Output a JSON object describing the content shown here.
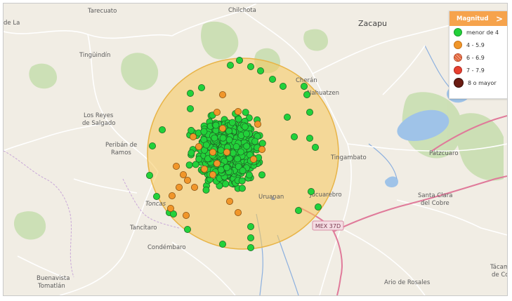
{
  "colors": {
    "circle_fill": "#f5c65a",
    "circle_stroke": "#e8b447",
    "menor4": "#22d13a",
    "m4_59": "#f0962a",
    "m6_69": "#e0643d",
    "m7_79": "#e84030",
    "m8": "#6b1c12",
    "legend_header": "#f6a34c",
    "road_major": "#e07a9a",
    "river": "#8cb0df",
    "lake": "#9fc3e8",
    "forest": "#c8deb0"
  },
  "places": [
    {
      "label": "Tarecuato"
    },
    {
      "label": "Chilchota"
    },
    {
      "label": "Zacapu"
    },
    {
      "label": "Tingüindín"
    },
    {
      "label": "Los Reyes"
    },
    {
      "label": "de Salgado"
    },
    {
      "label": "Peribán de"
    },
    {
      "label": "Ramos"
    },
    {
      "label": "Cherán"
    },
    {
      "label": "Nahuatzen"
    },
    {
      "label": "Tingambato"
    },
    {
      "label": "Pátzcuaro"
    },
    {
      "label": "Santa Clara"
    },
    {
      "label": "del Cobre"
    },
    {
      "label": "Tancítaro"
    },
    {
      "label": "Condémbaro"
    },
    {
      "label": "Uruapan"
    },
    {
      "label": "Jucuarebro"
    },
    {
      "label": "Buenavista"
    },
    {
      "label": "Tomatlán"
    },
    {
      "label": "Ario de Rosales"
    },
    {
      "label": "Tácam"
    },
    {
      "label": "de Co"
    },
    {
      "label": "de La"
    },
    {
      "label": "Toncas"
    }
  ],
  "highway_label": "MEX 37D",
  "legend": {
    "title": "Magnitud",
    "chevron": ">",
    "items": [
      {
        "label": "menor de 4",
        "color": "#22d13a",
        "pattern": "solid"
      },
      {
        "label": "4 - 5.9",
        "color": "#f0962a",
        "pattern": "solid"
      },
      {
        "label": "6 - 6.9",
        "color": "#e0643d",
        "pattern": "hatched"
      },
      {
        "label": "7 - 7.9",
        "color": "#e84030",
        "pattern": "solid"
      },
      {
        "label": "8 o mayor",
        "color": "#6b1c12",
        "pattern": "solid"
      }
    ]
  }
}
